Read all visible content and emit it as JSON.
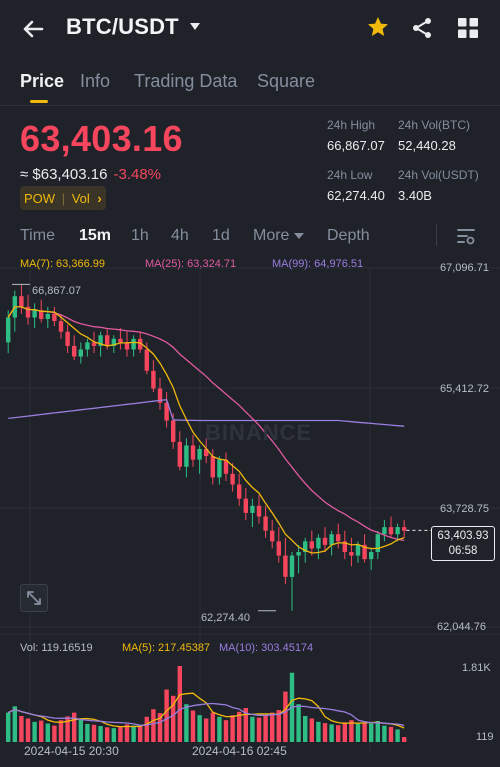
{
  "header": {
    "pair": "BTC/USDT",
    "icons": [
      "back-arrow-icon",
      "caret-down-icon",
      "star-icon",
      "share-icon",
      "grid-icon"
    ],
    "star_color": "#f0b90b"
  },
  "tabs": [
    "Price",
    "Info",
    "Trading Data",
    "Square"
  ],
  "price": {
    "last": "63,403.16",
    "approx": "≈ $63,403.16",
    "change": "-3.48%",
    "badge": "POW",
    "badge_sep": "|",
    "badge_vol": "Vol",
    "badge_chevron": "›"
  },
  "stats": {
    "high_label": "24h High",
    "high": "66,867.07",
    "low_label": "24h Low",
    "low": "62,274.40",
    "vol_btc_label": "24h Vol(BTC)",
    "vol_btc": "52,440.28",
    "vol_usdt_label": "24h Vol(USDT)",
    "vol_usdt": "3.40B"
  },
  "toolbar": {
    "time": "Time",
    "m15": "15m",
    "h1": "1h",
    "h4": "4h",
    "d1": "1d",
    "more": "More",
    "depth": "Depth"
  },
  "indicators": {
    "ma7": "MA(7): 63,366.99",
    "ma25": "MA(25): 63,324.71",
    "ma99": "MA(99): 64,976.51",
    "vol": "Vol: 119.16519",
    "vma5": "MA(5): 217.45387",
    "vma10": "MA(10): 303.45174",
    "ma7_color": "#f0b90b",
    "ma25_color": "#e05aa0",
    "ma99_color": "#9a7ee0"
  },
  "price_axis": [
    "67,096.71",
    "65,412.72",
    "63,728.75",
    "62,044.76"
  ],
  "vol_axis": [
    "1.81K",
    "119"
  ],
  "highlights": {
    "high": "66,867.07",
    "low": "62,274.40"
  },
  "current": {
    "price": "63,403.93",
    "countdown": "06:58"
  },
  "watermark": "BINANCE",
  "date_axis": [
    "2024-04-15 20:30",
    "2024-04-16 02:45"
  ],
  "colors": {
    "up": "#2ebd85",
    "down": "#f6465d",
    "accent": "#f0b90b",
    "bg": "#1f2229"
  },
  "chart_data": {
    "type": "candlestick",
    "interval": "15m",
    "price_axis_ticks": [
      67096.71,
      65412.72,
      63728.75,
      62044.76
    ],
    "volume_axis_ticks": [
      1810,
      119
    ],
    "candles": [
      [
        66050,
        66500,
        65900,
        66400,
        700
      ],
      [
        66400,
        66780,
        66200,
        66700,
        850
      ],
      [
        66700,
        66867,
        66450,
        66550,
        620
      ],
      [
        66550,
        66720,
        66300,
        66400,
        560
      ],
      [
        66400,
        66600,
        66250,
        66500,
        480
      ],
      [
        66500,
        66650,
        66330,
        66380,
        510
      ],
      [
        66380,
        66550,
        66250,
        66450,
        440
      ],
      [
        66450,
        66550,
        66280,
        66350,
        390
      ],
      [
        66350,
        66450,
        66100,
        66200,
        520
      ],
      [
        66200,
        66300,
        65900,
        66000,
        610
      ],
      [
        66000,
        66150,
        65800,
        65850,
        700
      ],
      [
        65850,
        66050,
        65750,
        65950,
        540
      ],
      [
        65950,
        66100,
        65850,
        66050,
        430
      ],
      [
        66050,
        66200,
        65900,
        66000,
        410
      ],
      [
        66000,
        66200,
        65850,
        66150,
        380
      ],
      [
        66150,
        66250,
        65950,
        66000,
        350
      ],
      [
        66000,
        66150,
        65900,
        66100,
        330
      ],
      [
        66100,
        66250,
        65950,
        66050,
        360
      ],
      [
        66050,
        66200,
        65850,
        65950,
        420
      ],
      [
        65950,
        66150,
        65850,
        66100,
        390
      ],
      [
        66100,
        66200,
        65900,
        65950,
        370
      ],
      [
        65950,
        66050,
        65600,
        65650,
        600
      ],
      [
        65650,
        65800,
        65350,
        65400,
        780
      ],
      [
        65400,
        65550,
        65100,
        65200,
        690
      ],
      [
        65200,
        65350,
        64850,
        64950,
        1250
      ],
      [
        64950,
        65050,
        64550,
        64650,
        1100
      ],
      [
        64650,
        64800,
        64250,
        64300,
        1810
      ],
      [
        64300,
        64700,
        64150,
        64600,
        900
      ],
      [
        64600,
        64750,
        64300,
        64400,
        750
      ],
      [
        64400,
        64600,
        64200,
        64550,
        640
      ],
      [
        64550,
        64700,
        64350,
        64450,
        560
      ],
      [
        64450,
        64550,
        64050,
        64150,
        700
      ],
      [
        64150,
        64450,
        64050,
        64400,
        600
      ],
      [
        64400,
        64500,
        64100,
        64200,
        520
      ],
      [
        64200,
        64350,
        63950,
        64050,
        640
      ],
      [
        64050,
        64200,
        63750,
        63850,
        720
      ],
      [
        63850,
        64000,
        63550,
        63650,
        810
      ],
      [
        63650,
        63850,
        63450,
        63750,
        600
      ],
      [
        63750,
        63900,
        63500,
        63600,
        580
      ],
      [
        63600,
        63750,
        63300,
        63400,
        640
      ],
      [
        63400,
        63550,
        63150,
        63250,
        700
      ],
      [
        63250,
        63450,
        62950,
        63050,
        760
      ],
      [
        63050,
        63300,
        62650,
        62750,
        1200
      ],
      [
        62750,
        63100,
        62274,
        63050,
        1650
      ],
      [
        63050,
        63200,
        62800,
        63100,
        900
      ],
      [
        63100,
        63300,
        62950,
        63250,
        620
      ],
      [
        63250,
        63400,
        63050,
        63150,
        560
      ],
      [
        63150,
        63350,
        63000,
        63300,
        480
      ],
      [
        63300,
        63450,
        63100,
        63200,
        450
      ],
      [
        63200,
        63400,
        63050,
        63350,
        420
      ],
      [
        63350,
        63500,
        63150,
        63250,
        400
      ],
      [
        63250,
        63400,
        63000,
        63100,
        470
      ],
      [
        63100,
        63300,
        62900,
        63050,
        520
      ],
      [
        63050,
        63250,
        62950,
        63200,
        430
      ],
      [
        63200,
        63350,
        62950,
        63000,
        460
      ],
      [
        63000,
        63150,
        62850,
        63100,
        440
      ],
      [
        63100,
        63400,
        63000,
        63350,
        500
      ],
      [
        63350,
        63550,
        63250,
        63450,
        390
      ],
      [
        63450,
        63600,
        63300,
        63350,
        360
      ],
      [
        63350,
        63500,
        63250,
        63450,
        300
      ],
      [
        63450,
        63550,
        63300,
        63400,
        119
      ]
    ],
    "ma7_last": 63366.99,
    "ma25_last": 63324.71,
    "ma99_last": 64976.51,
    "volume_ma5_last": 217.45387,
    "volume_ma10_last": 303.45174,
    "x_labels": [
      "2024-04-15 20:30",
      "2024-04-16 02:45"
    ],
    "grid": true
  }
}
